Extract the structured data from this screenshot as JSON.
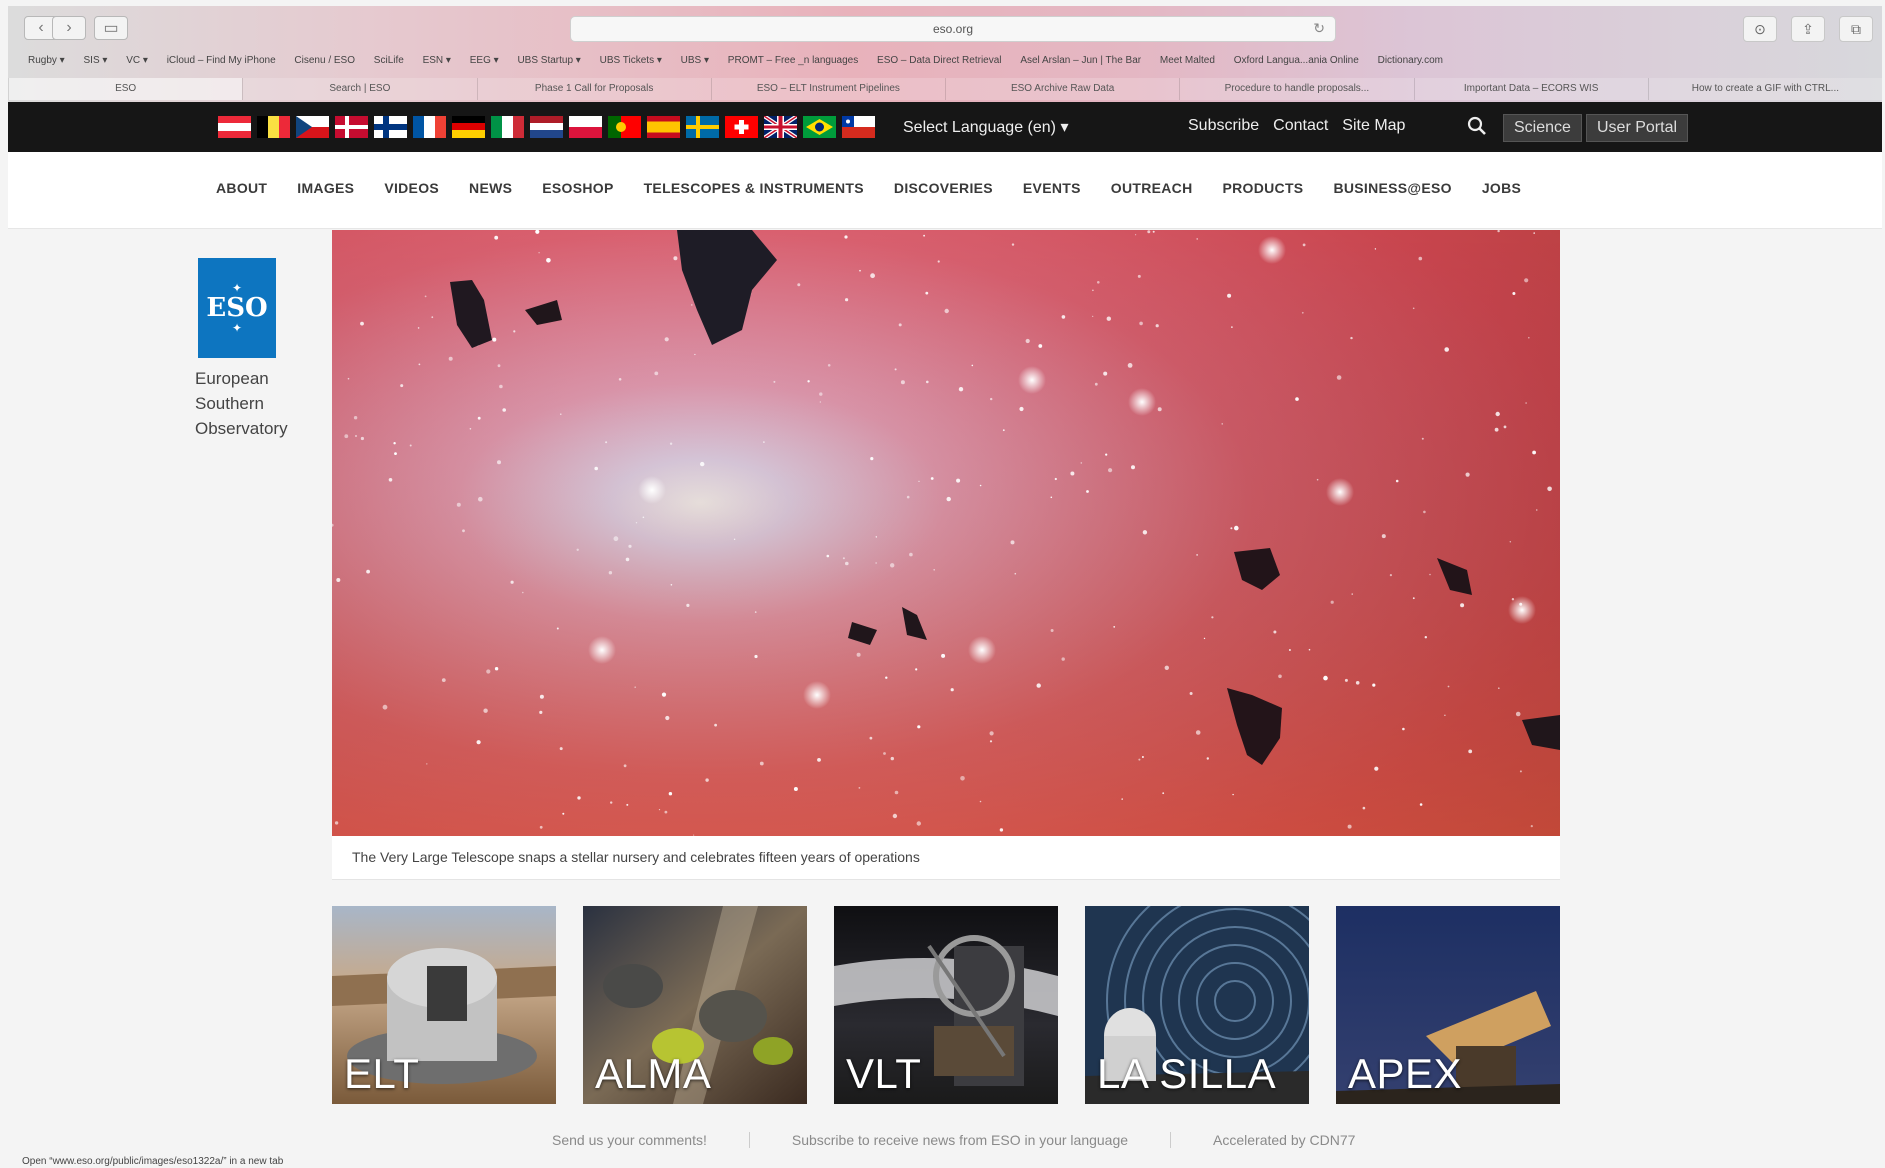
{
  "browser": {
    "url": "eso.org",
    "bookmarks": [
      "Rugby ▾",
      "SIS ▾",
      "VC ▾",
      "iCloud – Find My iPhone",
      "Cisenu / ESO",
      "SciLife",
      "ESN ▾",
      "EEG ▾",
      "UBS Startup ▾",
      "UBS Tickets ▾",
      "UBS ▾",
      "PROMT – Free _n languages",
      "ESO – Data Direct Retrieval",
      "Asel Arslan – Jun | The Bar",
      "Meet Malted",
      "Oxford Langua...ania Online",
      "Dictionary.com"
    ],
    "tabs": [
      "ESO",
      "Search | ESO",
      "Phase 1 Call for Proposals",
      "ESO – ELT Instrument Pipelines",
      "ESO Archive Raw Data",
      "Procedure to handle proposals...",
      "Important Data – ECORS WIS",
      "How to create a GIF with CTRL..."
    ]
  },
  "topbar": {
    "language_select": "Select Language (en) ▾",
    "links": [
      "Subscribe",
      "Contact",
      "Site Map"
    ],
    "science_button": "Science",
    "user_portal_button": "User Portal"
  },
  "mainnav": {
    "items": [
      "ABOUT",
      "IMAGES",
      "VIDEOS",
      "NEWS",
      "ESOSHOP",
      "TELESCOPES & INSTRUMENTS",
      "DISCOVERIES",
      "EVENTS",
      "OUTREACH",
      "PRODUCTS",
      "BUSINESS@ESO",
      "JOBS"
    ]
  },
  "logo": {
    "mark": "ESO",
    "line1": "European",
    "line2": "Southern",
    "line3": "Observatory"
  },
  "hero": {
    "caption": "The Very Large Telescope snaps a stellar nursery and celebrates fifteen years of operations"
  },
  "thumbnails": [
    "ELT",
    "ALMA",
    "VLT",
    "LA SILLA",
    "APEX"
  ],
  "footer": {
    "links": [
      "Send us your comments!",
      "Subscribe to receive news from ESO in your language",
      "Accelerated by CDN77"
    ]
  },
  "status_bar": "Open “www.eso.org/public/images/eso1322a/” in a new tab"
}
